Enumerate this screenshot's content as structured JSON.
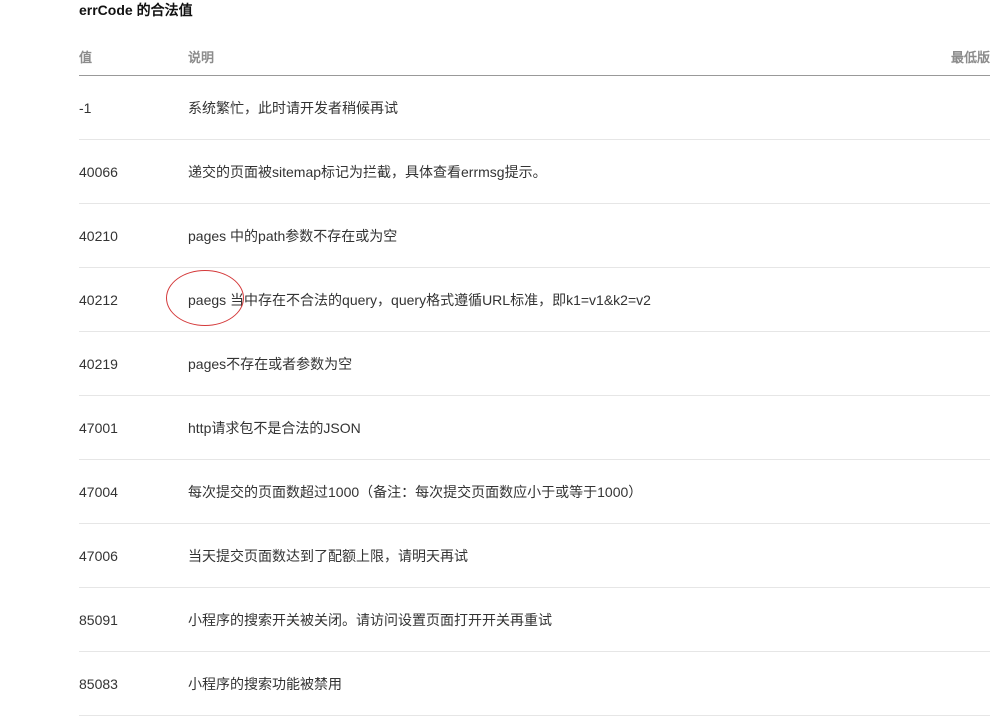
{
  "section": {
    "title": "errCode 的合法值"
  },
  "table": {
    "headers": {
      "value": "值",
      "description": "说明",
      "min_version": "最低版"
    },
    "rows": [
      {
        "code": "-1",
        "description": "系统繁忙，此时请开发者稍候再试"
      },
      {
        "code": "40066",
        "description": "递交的页面被sitemap标记为拦截，具体查看errmsg提示。"
      },
      {
        "code": "40210",
        "description": "pages 中的path参数不存在或为空"
      },
      {
        "code": "40212",
        "description": "paegs 当中存在不合法的query，query格式遵循URL标准，即k1=v1&k2=v2"
      },
      {
        "code": "40219",
        "description": "pages不存在或者参数为空"
      },
      {
        "code": "47001",
        "description": "http请求包不是合法的JSON"
      },
      {
        "code": "47004",
        "description": "每次提交的页面数超过1000（备注：每次提交页面数应小于或等于1000）"
      },
      {
        "code": "47006",
        "description": "当天提交页面数达到了配额上限，请明天再试"
      },
      {
        "code": "85091",
        "description": "小程序的搜索开关被关闭。请访问设置页面打开开关再重试"
      },
      {
        "code": "85083",
        "description": "小程序的搜索功能被禁用"
      }
    ]
  },
  "annotation": {
    "color": "#d4393a"
  }
}
